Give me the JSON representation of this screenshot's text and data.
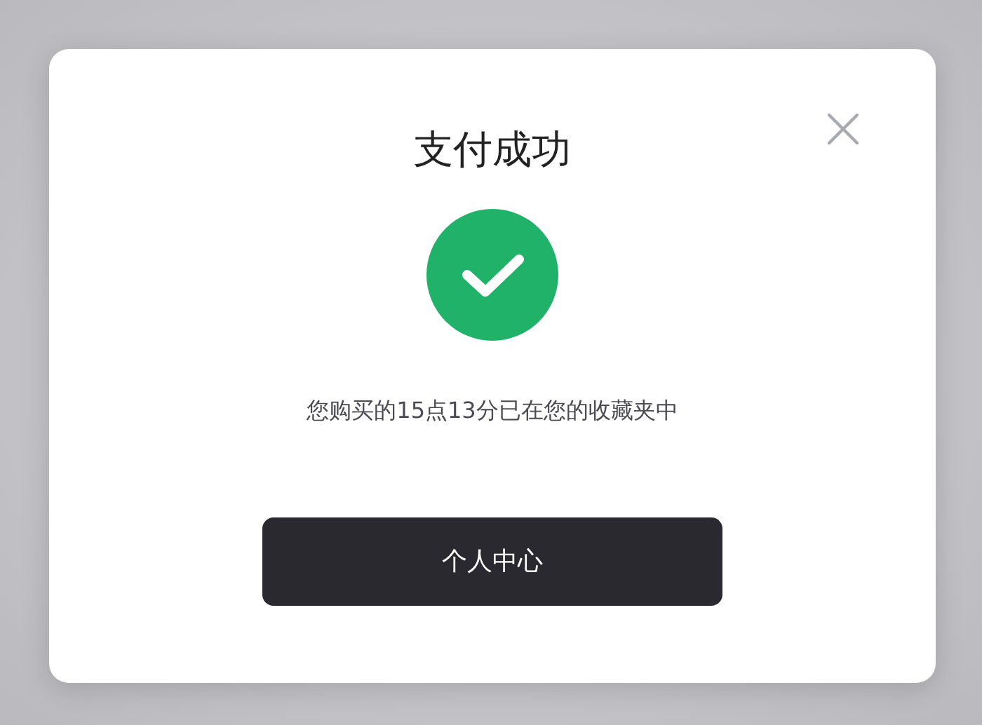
{
  "dialog": {
    "title": "支付成功",
    "message": "您购买的15点13分已在您的收藏夹中",
    "button": "个人中心"
  }
}
